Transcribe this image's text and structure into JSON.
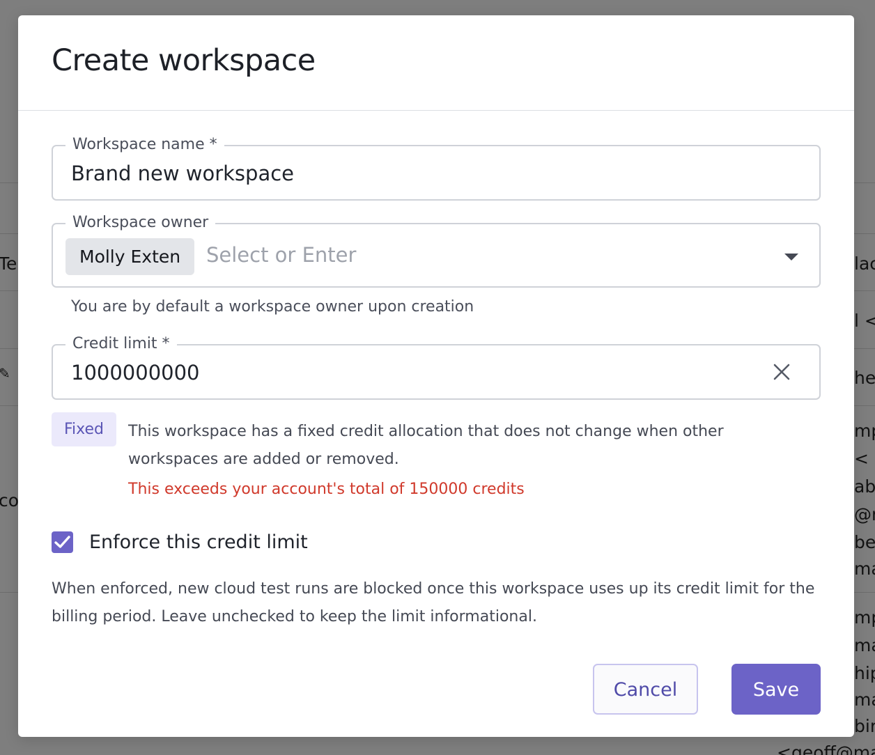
{
  "background": {
    "left_fragments": [
      "Te",
      "",
      "cos"
    ],
    "right_fragments": [
      "lac",
      "l <",
      "her",
      "mp",
      " <",
      "abl",
      "@m",
      "bel",
      "ma",
      "mp",
      "mal",
      "hip",
      "ma",
      "bira",
      "<geoff@ma"
    ]
  },
  "modal": {
    "title": "Create workspace",
    "workspace_name": {
      "label": "Workspace name *",
      "value": "Brand new workspace"
    },
    "workspace_owner": {
      "label": "Workspace owner",
      "chip": "Molly Exten",
      "placeholder": "Select or Enter",
      "helper": "You are by default a workspace owner upon creation"
    },
    "credit_limit": {
      "label": "Credit limit *",
      "value": "1000000000",
      "badge": "Fixed",
      "description": "This workspace has a fixed credit allocation that does not change when other workspaces are added or removed.",
      "error": "This exceeds your account's total of 150000 credits"
    },
    "enforce": {
      "checked": true,
      "label": "Enforce this credit limit",
      "note": "When enforced, new cloud test runs are blocked once this workspace uses up its credit limit for the billing period. Leave unchecked to keep the limit informational."
    },
    "buttons": {
      "cancel": "Cancel",
      "save": "Save"
    }
  },
  "colors": {
    "accent": "#6c63c7",
    "error": "#d0392b",
    "badge_bg": "#ebe9fb",
    "overlay": "#7e7e7e"
  },
  "icons": {
    "dropdown": "chevron-down-icon",
    "clear": "close-icon",
    "checkbox": "checkmark-icon"
  }
}
